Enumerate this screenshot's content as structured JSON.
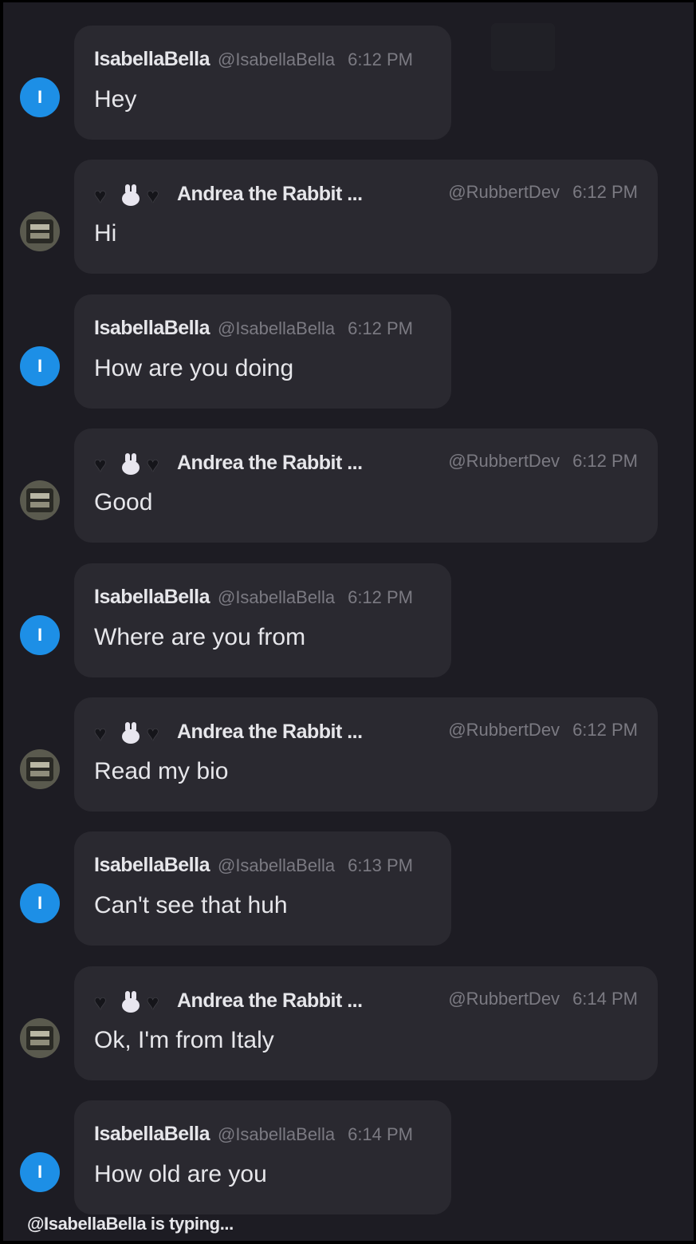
{
  "messages": [
    {
      "user": "IsabellaBella",
      "handle": "@IsabellaBella",
      "time": "6:12 PM",
      "text": "Hey",
      "avatar_letter": "I",
      "kind": "isabella"
    },
    {
      "user": "Andrea the Rabbit ...",
      "handle": "@RubbertDev",
      "time": "6:12 PM",
      "text": "Hi",
      "kind": "andrea"
    },
    {
      "user": "IsabellaBella",
      "handle": "@IsabellaBella",
      "time": "6:12 PM",
      "text": "How are you doing",
      "avatar_letter": "I",
      "kind": "isabella"
    },
    {
      "user": "Andrea the Rabbit ...",
      "handle": "@RubbertDev",
      "time": "6:12 PM",
      "text": "Good",
      "kind": "andrea"
    },
    {
      "user": "IsabellaBella",
      "handle": "@IsabellaBella",
      "time": "6:12 PM",
      "text": "Where are you from",
      "avatar_letter": "I",
      "kind": "isabella"
    },
    {
      "user": "Andrea the Rabbit ...",
      "handle": "@RubbertDev",
      "time": "6:12 PM",
      "text": "Read my bio",
      "kind": "andrea"
    },
    {
      "user": "IsabellaBella",
      "handle": "@IsabellaBella",
      "time": "6:13 PM",
      "text": "Can't see that huh",
      "avatar_letter": "I",
      "kind": "isabella"
    },
    {
      "user": "Andrea the Rabbit ...",
      "handle": "@RubbertDev",
      "time": "6:14 PM",
      "text": "Ok, I'm from Italy",
      "kind": "andrea"
    },
    {
      "user": "IsabellaBella",
      "handle": "@IsabellaBella",
      "time": "6:14 PM",
      "text": "How old are you",
      "avatar_letter": "I",
      "kind": "isabella"
    }
  ],
  "andrea_name_icons": [
    "black-heart-icon",
    "rabbit-face-icon",
    "black-heart-icon"
  ],
  "typing_indicator": "@IsabellaBella is typing...",
  "colors": {
    "background": "#1d1c23",
    "bubble": "#2a2930",
    "avatar_blue": "#1d8fe6",
    "text": "#e6e6ea",
    "muted": "#7b7a82"
  }
}
